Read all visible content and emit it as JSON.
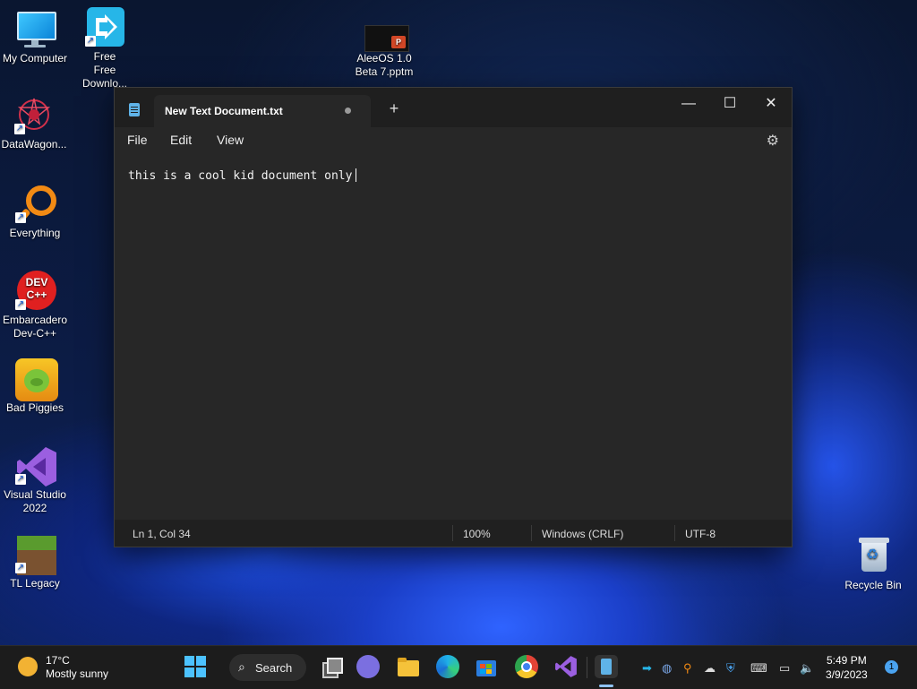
{
  "desktop": {
    "icons": [
      {
        "label": "My Computer"
      },
      {
        "label": "Free Downlo..."
      },
      {
        "label": "AleeOS 1.0 Beta 7.pptm"
      },
      {
        "label": "DataWagon..."
      },
      {
        "label": "Everything"
      },
      {
        "label": "Embarcadero Dev-C++"
      },
      {
        "label": "Bad Piggies"
      },
      {
        "label": "Visual Studio 2022"
      },
      {
        "label": "TL Legacy"
      },
      {
        "label": "Recycle Bin"
      }
    ],
    "devcpp_badge": "DEV C++"
  },
  "notepad": {
    "tab_title": "New Text Document.txt",
    "new_tab": "+",
    "window_buttons": {
      "minimize": "—",
      "maximize": "☐",
      "close": "✕"
    },
    "menu": {
      "file": "File",
      "edit": "Edit",
      "view": "View"
    },
    "content": "this is a cool kid document only",
    "status": {
      "position": "Ln 1, Col 34",
      "zoom": "100%",
      "line_ending": "Windows (CRLF)",
      "encoding": "UTF-8"
    }
  },
  "taskbar": {
    "weather_temp": "17°C",
    "weather_desc": "Mostly sunny",
    "search_label": "Search",
    "time": "5:49 PM",
    "date": "3/9/2023",
    "notification_count": "1"
  },
  "icons": {
    "settings": "gear-icon",
    "search": "search-icon",
    "volume": "speaker-icon"
  },
  "colors": {
    "accent": "#5fb3e8",
    "window_bg": "#272727",
    "titlebar_bg": "#1f1f1f",
    "taskbar_bg": "#1c1c1c"
  }
}
